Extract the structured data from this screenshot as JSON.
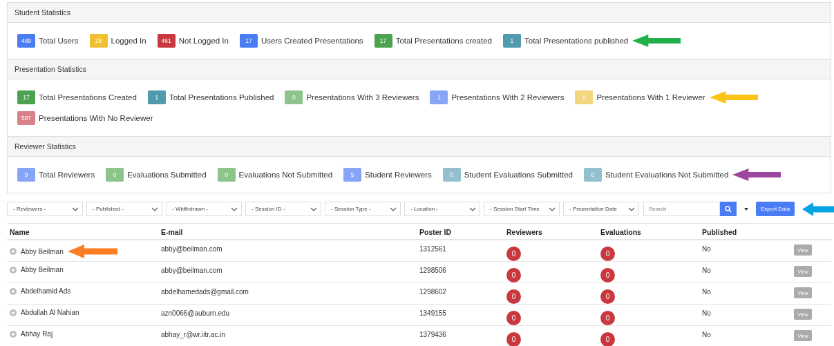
{
  "panels": [
    {
      "title": "Student Statistics",
      "stats": [
        {
          "count": "489",
          "label": "Total Users",
          "color": "#4a7cf3"
        },
        {
          "count": "28",
          "label": "Logged In",
          "color": "#f0c030"
        },
        {
          "count": "461",
          "label": "Not Logged In",
          "color": "#c9383e"
        },
        {
          "count": "17",
          "label": "Users Created Presentations",
          "color": "#4a7cf3"
        },
        {
          "count": "17",
          "label": "Total Presentations created",
          "color": "#4ca24e"
        },
        {
          "count": "1",
          "label": "Total Presentations published",
          "color": "#4f9aac",
          "arrow": {
            "color": "#22b04b"
          }
        }
      ]
    },
    {
      "title": "Presentation Statistics",
      "stats": [
        {
          "count": "17",
          "label": "Total Presentations Created",
          "color": "#4ca24e"
        },
        {
          "count": "1",
          "label": "Total Presentations Published",
          "color": "#4f9aac"
        },
        {
          "count": "0",
          "label": "Presentations With 3 Reviewers",
          "color": "#8cc48b"
        },
        {
          "count": "1",
          "label": "Presentations With 2 Reviewers",
          "color": "#86a5f7"
        },
        {
          "count": "8",
          "label": "Presentations With 1 Reviewer",
          "color": "#f2d57c",
          "arrow": {
            "color": "#fcc316"
          }
        },
        {
          "count": "587",
          "label": "Presentations With No Reviewer",
          "color": "#d9808a"
        }
      ]
    },
    {
      "title": "Reviewer Statistics",
      "stats": [
        {
          "count": "9",
          "label": "Total Reviewers",
          "color": "#86a5f7"
        },
        {
          "count": "0",
          "label": "Evaluations Submitted",
          "color": "#8cc48b"
        },
        {
          "count": "0",
          "label": "Evaluations Not Submitted",
          "color": "#8cc48b"
        },
        {
          "count": "5",
          "label": "Student Reviewers",
          "color": "#86a5f7"
        },
        {
          "count": "0",
          "label": "Student Evaluations Submitted",
          "color": "#93c0cf"
        },
        {
          "count": "0",
          "label": "Student Evaluations Not Submitted",
          "color": "#93c0cf",
          "arrow": {
            "color": "#9d469e"
          }
        }
      ]
    }
  ],
  "filters": [
    "- Reviewers -",
    "- Published -",
    "- Widthdrawn -",
    "- Session ID -",
    "- Session Type -",
    "- Location -",
    "- Session Start Time",
    "- Presentation Date"
  ],
  "search": {
    "placeholder": "Search"
  },
  "export_button": {
    "label": "Export Data",
    "arrow": {
      "color": "#04a4e4"
    }
  },
  "table": {
    "columns": [
      "Name",
      "E-mail",
      "Poster ID",
      "Reviewers",
      "Evaluations",
      "Published"
    ],
    "rows": [
      {
        "name": "Abby Beilman",
        "email": "abby@beilman.com",
        "poster_id": "1312561",
        "reviewers": "0",
        "evaluations": "0",
        "published": "No",
        "action": "View",
        "arrow": {
          "color": "#fd7e22"
        }
      },
      {
        "name": "Abby Beilman",
        "email": "abby@beilman.com",
        "poster_id": "1298506",
        "reviewers": "0",
        "evaluations": "0",
        "published": "No",
        "action": "View"
      },
      {
        "name": "Abdelhamid Ads",
        "email": "abdelhamedads@gmail.com",
        "poster_id": "1298602",
        "reviewers": "0",
        "evaluations": "0",
        "published": "No",
        "action": "View"
      },
      {
        "name": "Abdullah Al Nahian",
        "email": "azn0066@auburn.edu",
        "poster_id": "1349155",
        "reviewers": "0",
        "evaluations": "0",
        "published": "No",
        "action": "View"
      },
      {
        "name": "Abhay Raj",
        "email": "abhay_r@wr.iitr.ac.in",
        "poster_id": "1379436",
        "reviewers": "0",
        "evaluations": "0",
        "published": "No",
        "action": "View"
      }
    ]
  }
}
